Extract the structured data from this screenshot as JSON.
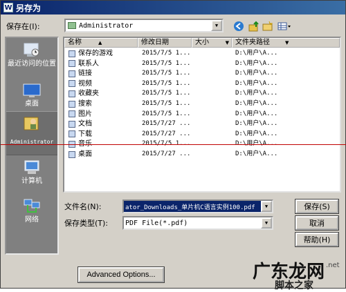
{
  "window": {
    "title": "另存为"
  },
  "save_in": {
    "label": "保存在(I):",
    "value": "Administrator"
  },
  "places": [
    {
      "label": "最近访问的位置",
      "icon": "recent-places-icon"
    },
    {
      "label": "桌面",
      "icon": "desktop-icon"
    },
    {
      "label": "Administrator",
      "icon": "user-folder-icon",
      "selected": true
    },
    {
      "label": "计算机",
      "icon": "computer-icon"
    },
    {
      "label": "网络",
      "icon": "network-icon"
    }
  ],
  "columns": {
    "name": "名称",
    "date": "修改日期",
    "size": "大小",
    "folder": "文件夹路径"
  },
  "files": [
    {
      "name": "保存的游戏",
      "date": "2015/7/5 1...",
      "path": "D:\\用户\\A..."
    },
    {
      "name": "联系人",
      "date": "2015/7/5 1...",
      "path": "D:\\用户\\A..."
    },
    {
      "name": "链接",
      "date": "2015/7/5 1...",
      "path": "D:\\用户\\A..."
    },
    {
      "name": "视频",
      "date": "2015/7/5 1...",
      "path": "D:\\用户\\A..."
    },
    {
      "name": "收藏夹",
      "date": "2015/7/5 1...",
      "path": "D:\\用户\\A..."
    },
    {
      "name": "搜索",
      "date": "2015/7/5 1...",
      "path": "D:\\用户\\A..."
    },
    {
      "name": "图片",
      "date": "2015/7/5 1...",
      "path": "D:\\用户\\A..."
    },
    {
      "name": "文档",
      "date": "2015/7/27 ...",
      "path": "D:\\用户\\A..."
    },
    {
      "name": "下载",
      "date": "2015/7/27 ...",
      "path": "D:\\用户\\A..."
    },
    {
      "name": "音乐",
      "date": "2015/7/5 1...",
      "path": "D:\\用户\\A..."
    },
    {
      "name": "桌面",
      "date": "2015/7/27 ...",
      "path": "D:\\用户\\A..."
    }
  ],
  "filename": {
    "label": "文件名(N):",
    "value": "ator_Downloads_单片机C语言实例100.pdf"
  },
  "filetype": {
    "label": "保存类型(T):",
    "value": "PDF File(*.pdf)"
  },
  "buttons": {
    "save": "保存(S)",
    "cancel": "取消",
    "help": "帮助(H)",
    "advanced": "Advanced Options..."
  },
  "watermark": {
    "main": "广东龙网",
    "sub": "脚本之家",
    "suffix": ".net"
  }
}
